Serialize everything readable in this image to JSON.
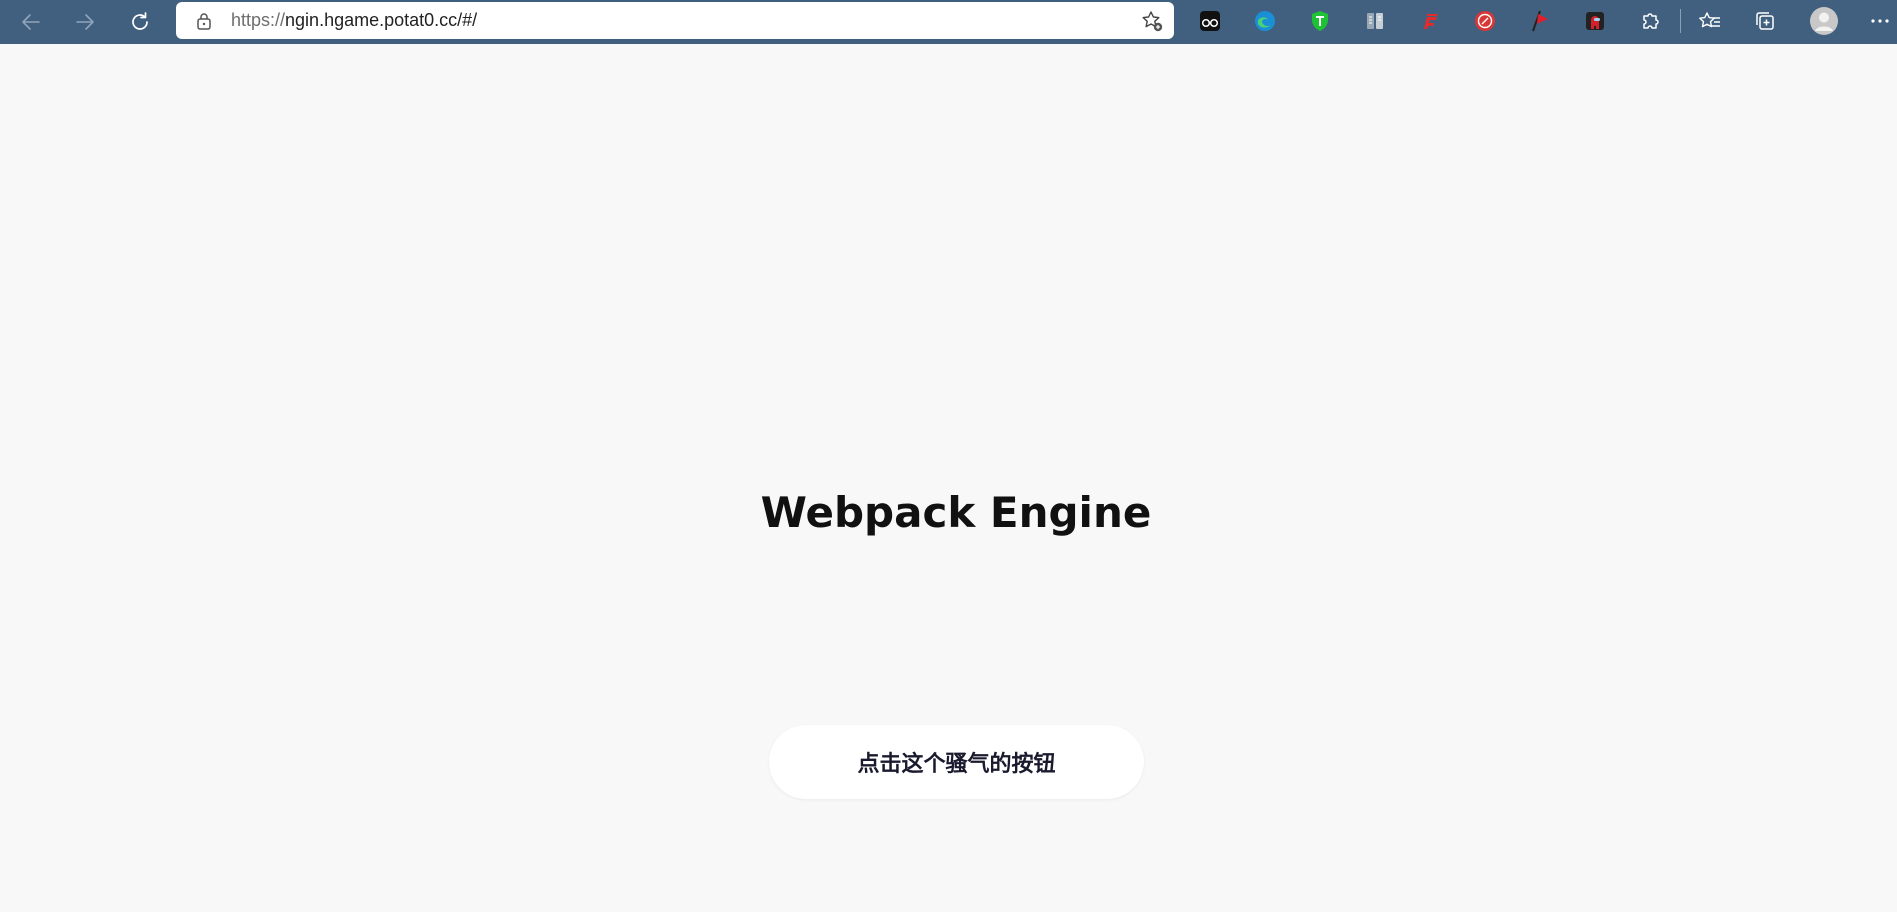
{
  "browser": {
    "url_protocol": "https://",
    "url_rest": "ngin.hgame.potat0.cc/#/",
    "accent_color": "#41607f",
    "nav_icons": [
      "back-arrow-icon",
      "forward-arrow-icon",
      "refresh-icon"
    ],
    "extension_icons": [
      "sunglasses-extension-icon",
      "edge-logo-extension-icon",
      "shield-extension-icon",
      "reader-extension-icon",
      "flash-extension-icon",
      "red-circle-extension-icon",
      "red-flag-extension-icon",
      "amongus-extension-icon",
      "puzzle-extensions-icon",
      "favorites-icon",
      "collections-icon",
      "profile-avatar-icon",
      "more-menu-icon"
    ]
  },
  "page": {
    "title": "Webpack Engine",
    "button_label": "点击这个骚气的按钮"
  }
}
